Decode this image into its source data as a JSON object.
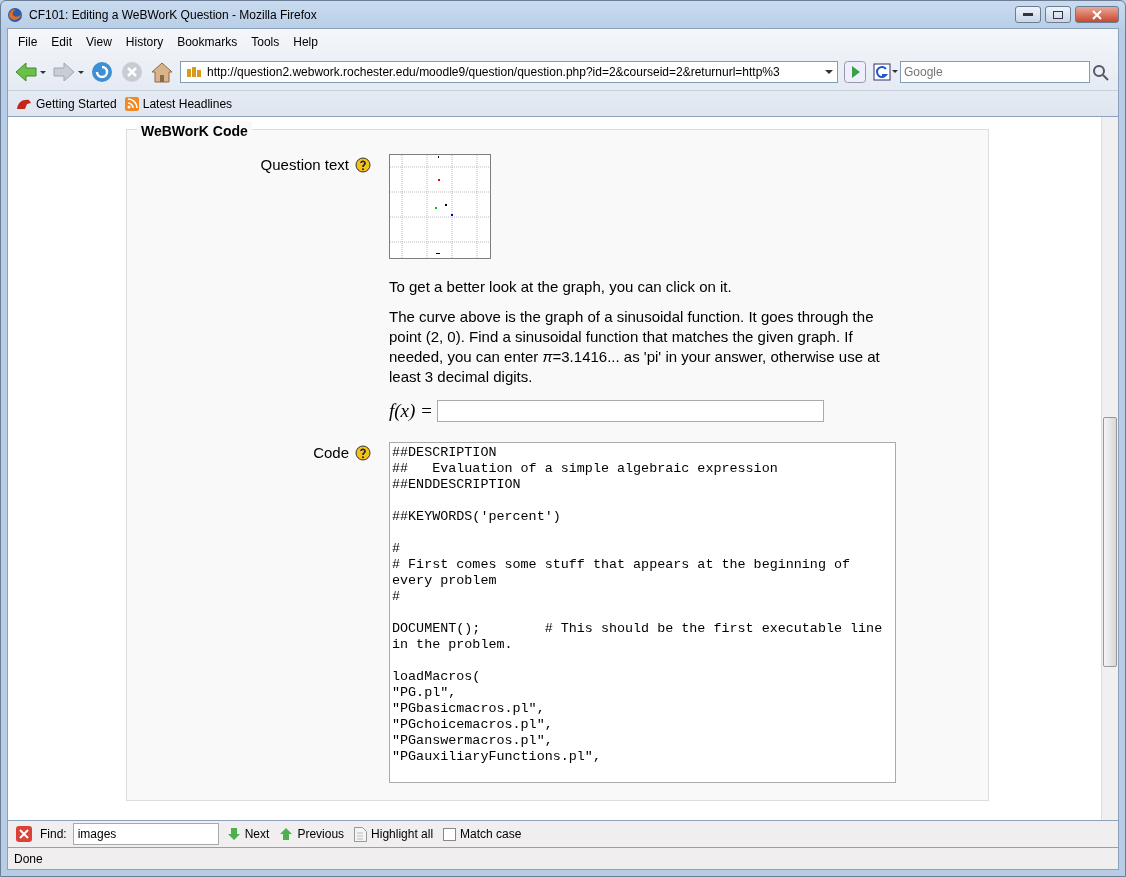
{
  "window": {
    "title": "CF101: Editing a WeBWorK Question - Mozilla Firefox"
  },
  "menu": [
    "File",
    "Edit",
    "View",
    "History",
    "Bookmarks",
    "Tools",
    "Help"
  ],
  "address_bar": {
    "value": "http://question2.webwork.rochester.edu/moodle9/question/question.php?id=2&courseid=2&returnurl=http%3"
  },
  "search_box": {
    "placeholder": "Google"
  },
  "bookmarks": [
    "Getting Started",
    "Latest Headlines"
  ],
  "section": {
    "title": "WeBWorK Code"
  },
  "question": {
    "label": "Question text",
    "hint": "To get a better look at the graph, you can click on it.",
    "body": "The curve above is the graph of a sinusoidal function. It goes through the point (2, 0). Find a sinusoidal function that matches the given graph. If needed, you can enter *π*=3.1416... as 'pi' in your answer, otherwise use at least 3 decimal digits.",
    "answer_label": "f(x) ="
  },
  "code": {
    "label": "Code",
    "value": "##DESCRIPTION\n##   Evaluation of a simple algebraic expression\n##ENDDESCRIPTION\n\n##KEYWORDS('percent')\n\n#\n# First comes some stuff that appears at the beginning of every problem\n#\n\nDOCUMENT();        # This should be the first executable line in the problem.\n\nloadMacros(\n\"PG.pl\",\n\"PGbasicmacros.pl\",\n\"PGchoicemacros.pl\",\n\"PGanswermacros.pl\",\n\"PGauxiliaryFunctions.pl\","
  },
  "find_bar": {
    "label": "Find:",
    "value": "images",
    "next": "Next",
    "previous": "Previous",
    "highlight": "Highlight all",
    "match_case": {
      "label": "Match case",
      "checked": false
    }
  },
  "status_bar": "Done"
}
